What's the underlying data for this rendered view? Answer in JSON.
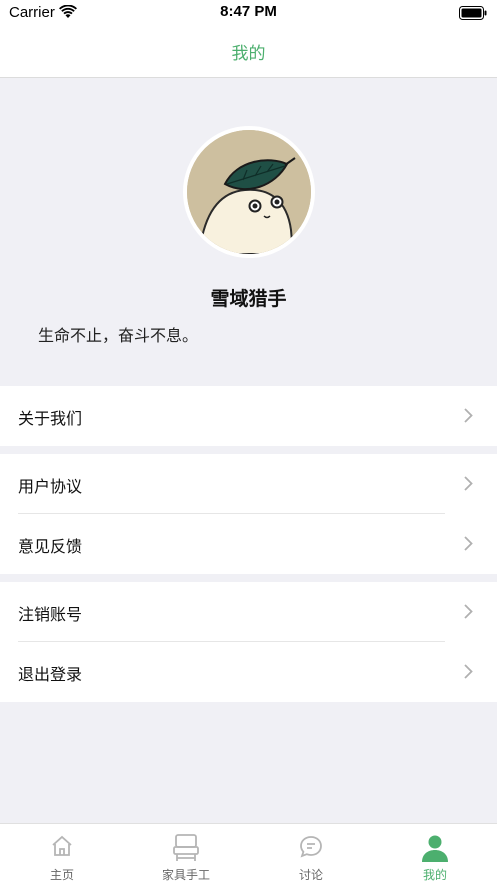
{
  "status_bar": {
    "carrier": "Carrier",
    "time": "8:47 PM"
  },
  "nav": {
    "title": "我的"
  },
  "profile": {
    "username": "雪域猎手",
    "bio": "生命不止，奋斗不息。"
  },
  "menu": {
    "group1": [
      {
        "label": "关于我们"
      }
    ],
    "group2": [
      {
        "label": "用户协议"
      },
      {
        "label": "意见反馈"
      }
    ],
    "group3": [
      {
        "label": "注销账号"
      },
      {
        "label": "退出登录"
      }
    ]
  },
  "tabs": [
    {
      "label": "主页",
      "icon": "home-icon",
      "active": false
    },
    {
      "label": "家具手工",
      "icon": "furniture-icon",
      "active": false
    },
    {
      "label": "讨论",
      "icon": "chat-icon",
      "active": false
    },
    {
      "label": "我的",
      "icon": "person-icon",
      "active": true
    }
  ],
  "colors": {
    "accent": "#4caf6e",
    "background": "#f0f0f5"
  }
}
